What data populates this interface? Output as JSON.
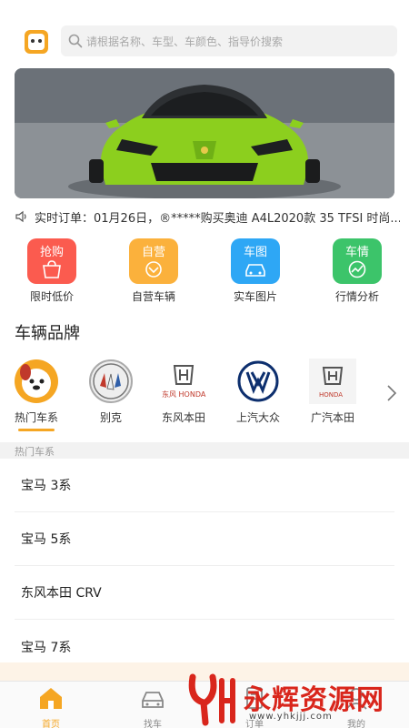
{
  "search": {
    "placeholder": "请根据名称、车型、车颜色、指导价搜索"
  },
  "ticker": {
    "text": "实时订单：01月26日，®*****购买奥迪 A4L2020款 35 TFSI 时尚..."
  },
  "features": [
    {
      "badge": "抢购",
      "label": "限时低价",
      "color": "#fb5b4f"
    },
    {
      "badge": "自营",
      "label": "自营车辆",
      "color": "#fbb13c"
    },
    {
      "badge": "车图",
      "label": "实车图片",
      "color": "#2ea7f5"
    },
    {
      "badge": "车情",
      "label": "行情分析",
      "color": "#3cc46a"
    }
  ],
  "brands_title": "车辆品牌",
  "brands": [
    {
      "label": "热门车系"
    },
    {
      "label": "别克"
    },
    {
      "label": "东风本田"
    },
    {
      "label": "上汽大众"
    },
    {
      "label": "广汽本田"
    }
  ],
  "hot_section": "热门车系",
  "hot_list": [
    "宝马 3系",
    "宝马 5系",
    "东风本田 CRV",
    "宝马 7系"
  ],
  "tabs": [
    {
      "label": "首页",
      "icon": "home-icon"
    },
    {
      "label": "找车",
      "icon": "car-icon"
    },
    {
      "label": "订单",
      "icon": "order-icon"
    },
    {
      "label": "我的",
      "icon": "user-icon"
    }
  ],
  "watermark": {
    "title": "永辉资源网",
    "url": "www.yhkjjj.com"
  },
  "colors": {
    "accent": "#f5a623",
    "car": "#8ccf1e"
  }
}
